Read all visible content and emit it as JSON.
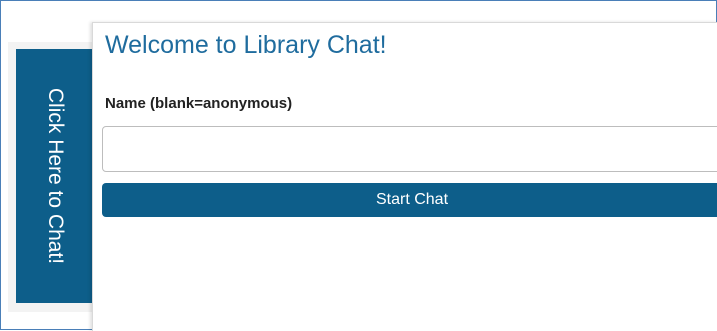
{
  "side_tab": {
    "label": "Click Here to Chat!"
  },
  "chat_panel": {
    "title": "Welcome to Library Chat!",
    "name_field": {
      "label": "Name (blank=anonymous)",
      "value": "",
      "placeholder": ""
    },
    "start_button_label": "Start Chat"
  },
  "colors": {
    "accent": "#0d5e8a",
    "title": "#1f6c9e",
    "frame_border": "#4a7fb8"
  }
}
